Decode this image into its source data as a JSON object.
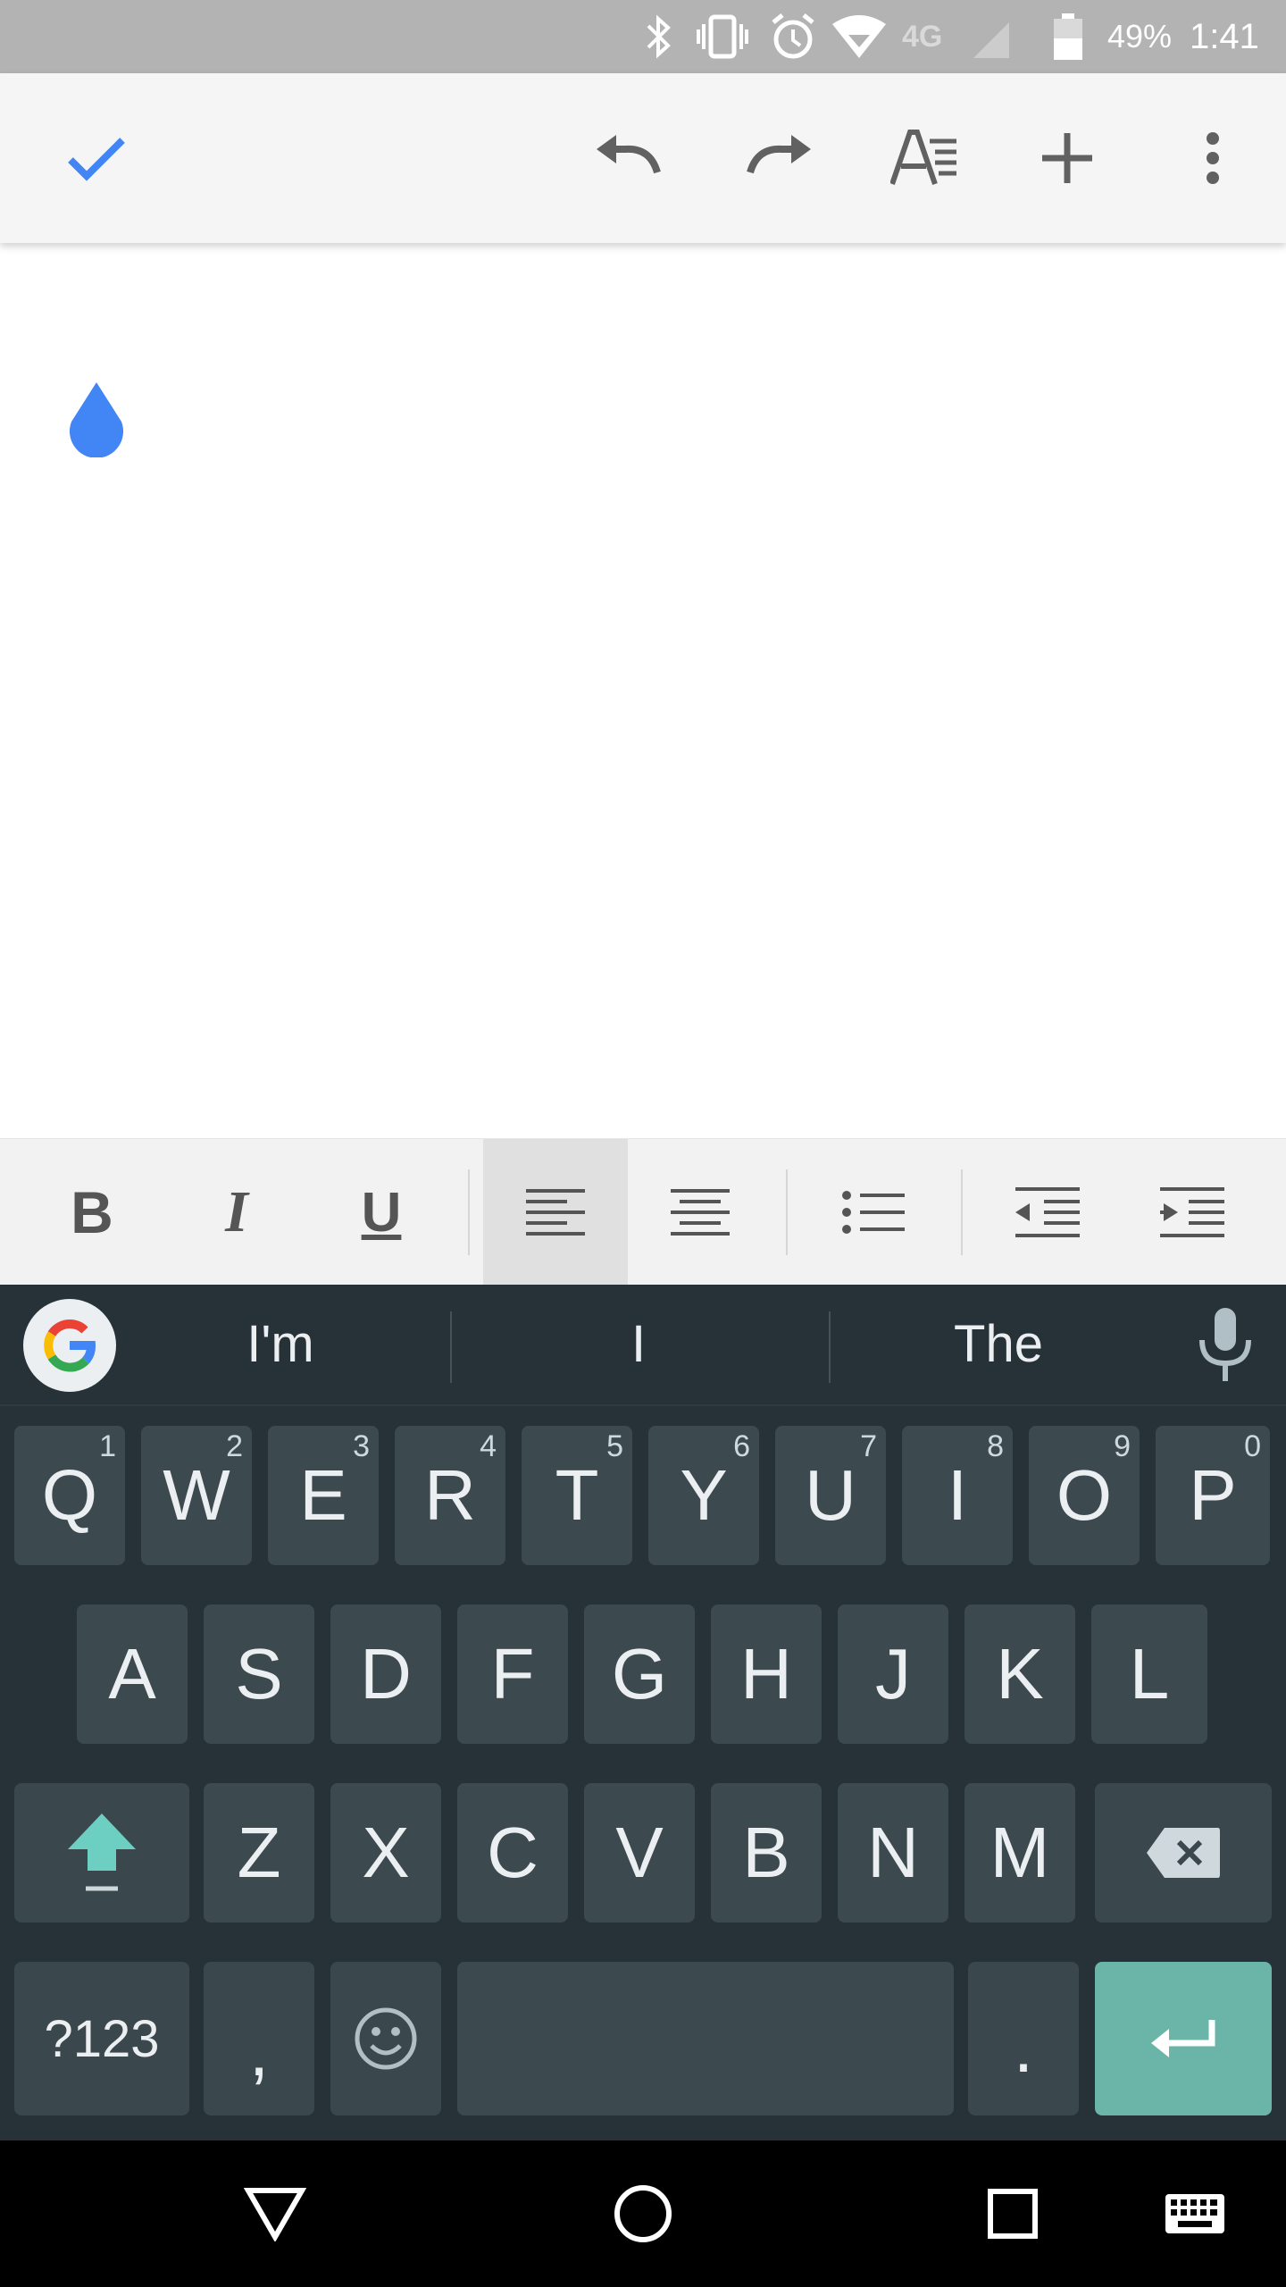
{
  "status_bar": {
    "network": "4G",
    "battery": "49%",
    "time": "1:41"
  },
  "toolbar": {
    "done_icon": "check-icon",
    "undo_icon": "undo-icon",
    "redo_icon": "redo-icon",
    "text_format_icon": "text-format-icon",
    "insert_icon": "plus-icon",
    "more_icon": "more-vert-icon",
    "accent": "#4285f4"
  },
  "format_bar": {
    "bold": "B",
    "italic": "I",
    "underline": "U",
    "active": "align-left"
  },
  "suggestions": [
    "I'm",
    "I",
    "The"
  ],
  "keyboard": {
    "row1": [
      {
        "key": "Q",
        "hint": "1"
      },
      {
        "key": "W",
        "hint": "2"
      },
      {
        "key": "E",
        "hint": "3"
      },
      {
        "key": "R",
        "hint": "4"
      },
      {
        "key": "T",
        "hint": "5"
      },
      {
        "key": "Y",
        "hint": "6"
      },
      {
        "key": "U",
        "hint": "7"
      },
      {
        "key": "I",
        "hint": "8"
      },
      {
        "key": "O",
        "hint": "9"
      },
      {
        "key": "P",
        "hint": "0"
      }
    ],
    "row2": [
      "A",
      "S",
      "D",
      "F",
      "G",
      "H",
      "J",
      "K",
      "L"
    ],
    "row3": [
      "Z",
      "X",
      "C",
      "V",
      "B",
      "N",
      "M"
    ],
    "symbols_label": "?123",
    "comma": ",",
    "period": ".",
    "accent": "#6ab4a8"
  }
}
